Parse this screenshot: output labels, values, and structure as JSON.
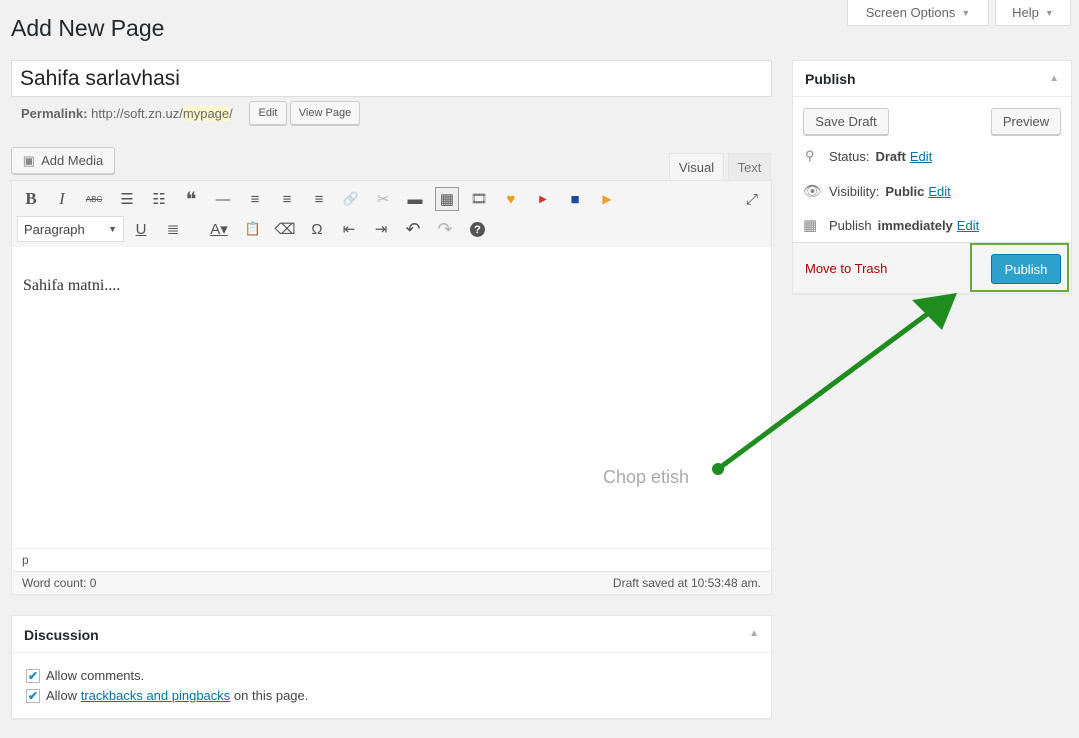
{
  "header": {
    "title": "Add New Page",
    "screen_options": "Screen Options",
    "help": "Help"
  },
  "editor": {
    "title_value": "Sahifa sarlavhasi",
    "permalink_label": "Permalink:",
    "permalink_base": "http://soft.zn.uz/",
    "permalink_slug": "mypage",
    "permalink_end": "/",
    "edit_btn": "Edit",
    "view_btn": "View Page",
    "add_media": "Add Media",
    "tabs": [
      "Visual",
      "Text"
    ],
    "format_select": "Paragraph",
    "content": "Sahifa matni....",
    "path": "p",
    "word_count": "Word count: 0",
    "draft_saved": "Draft saved at 10:53:48 am."
  },
  "annotation": {
    "text": "Chop etish",
    "color": "#1e8c1e"
  },
  "publish": {
    "title": "Publish",
    "save_draft": "Save Draft",
    "preview": "Preview",
    "status_label": "Status:",
    "status_value": "Draft",
    "visibility_label": "Visibility:",
    "visibility_value": "Public",
    "publish_label": "Publish",
    "publish_value": "immediately",
    "edit": "Edit",
    "trash": "Move to Trash",
    "publish_btn": "Publish",
    "accent": "#2ea2cc"
  },
  "discussion": {
    "title": "Discussion",
    "allow_comments": "Allow comments.",
    "allow_prefix": "Allow",
    "trackbacks_link": "trackbacks and pingbacks",
    "allow_suffix": "on this page."
  }
}
